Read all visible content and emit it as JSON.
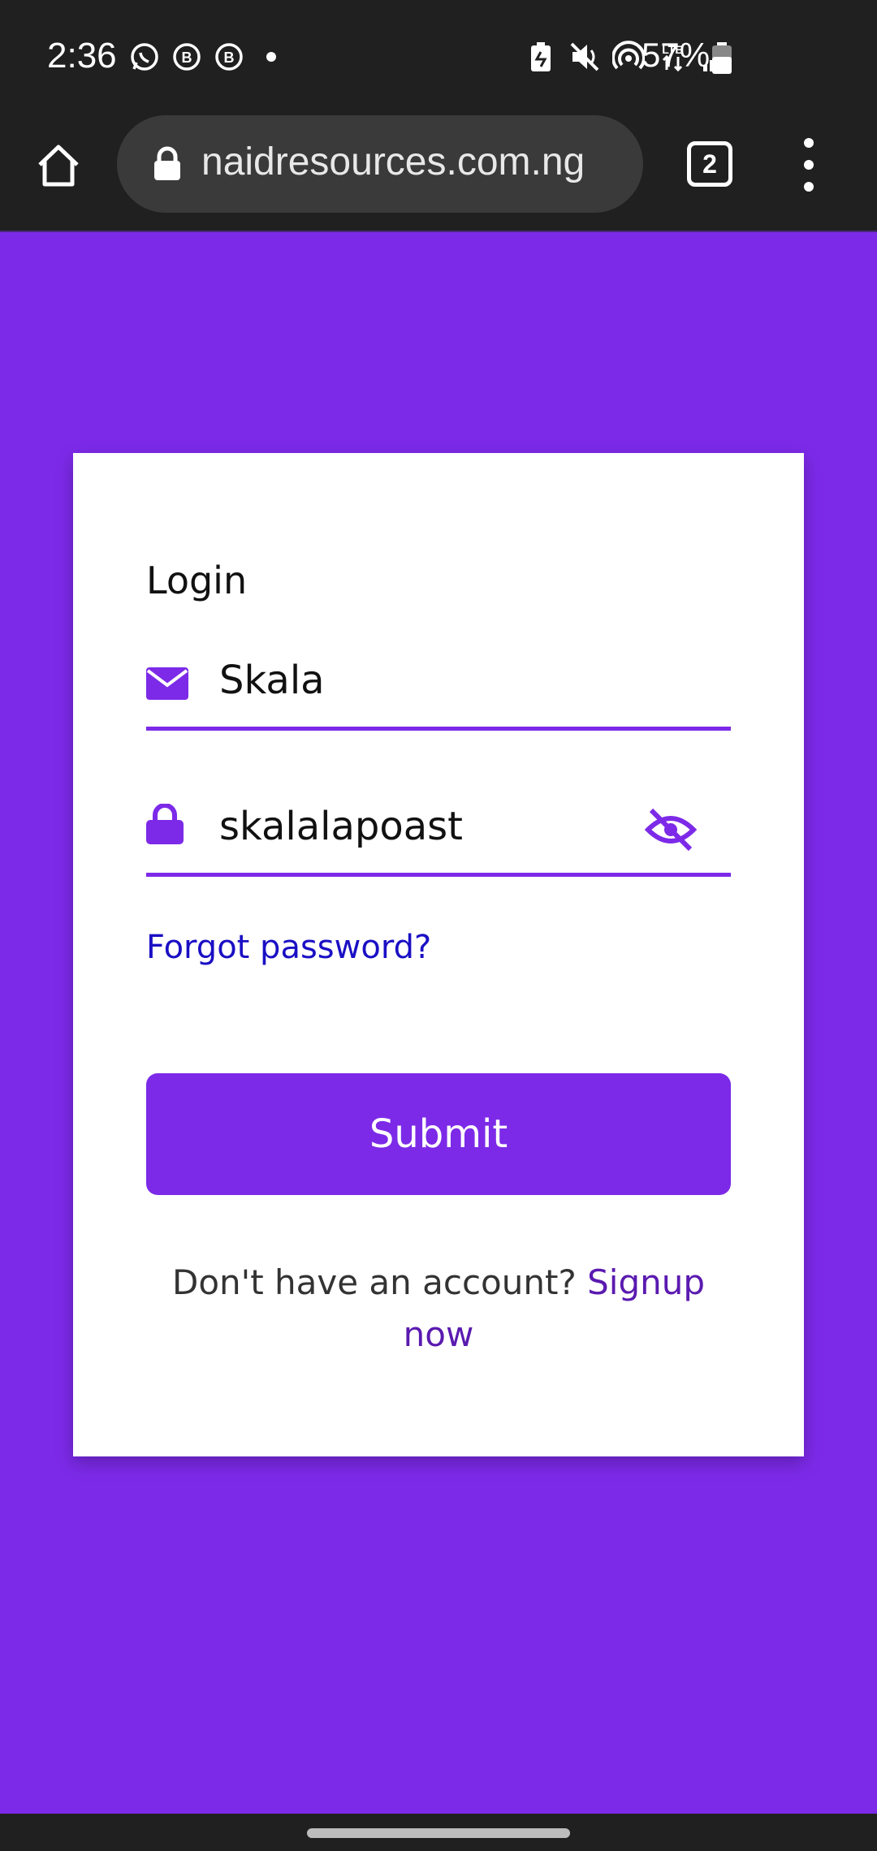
{
  "status_bar": {
    "time": "2:36",
    "battery_percent": "57%",
    "notification_icons": [
      "whatsapp-icon",
      "b-badge-icon",
      "b-badge-icon",
      "dot"
    ],
    "system_icons": [
      "battery-saver-icon",
      "mute-icon",
      "hotspot-icon",
      "lte-icon",
      "signal-icon",
      "battery-icon"
    ]
  },
  "browser": {
    "url": "naidresources.com.ng",
    "tab_count": "2"
  },
  "login": {
    "title": "Login",
    "email_value": "Skala",
    "password_value": "skalalapoast",
    "forgot_password": "Forgot password?",
    "submit_label": "Submit",
    "signup_prompt": "Don't have an account? ",
    "signup_link": "Signup now"
  },
  "colors": {
    "accent": "#7c2ae8",
    "link": "#1a0fc4",
    "signup_link": "#5a1ab0",
    "status_bar_bg": "#202020"
  }
}
